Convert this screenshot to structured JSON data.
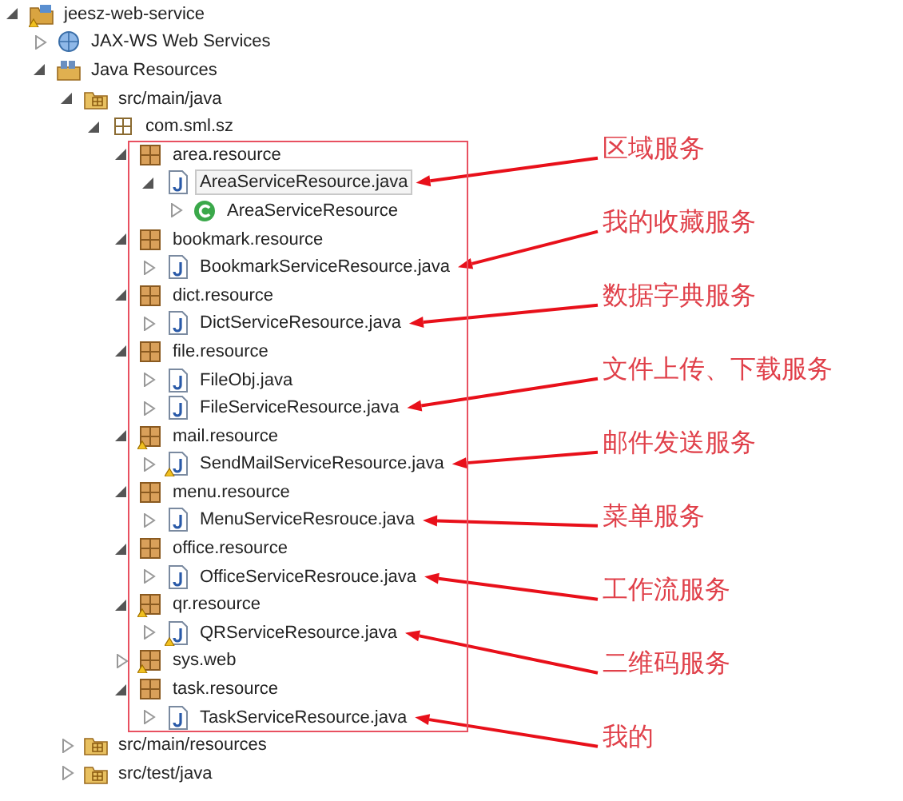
{
  "tree": [
    {
      "label": "jeesz-web-service",
      "kind": "project",
      "expanded": true,
      "warning": true,
      "selected": false,
      "children": [
        {
          "label": "JAX-WS Web Services",
          "kind": "web-services",
          "expanded": false,
          "warning": false,
          "selected": false
        },
        {
          "label": "Java Resources",
          "kind": "library-container",
          "expanded": true,
          "warning": false,
          "selected": false,
          "children": [
            {
              "label": "src/main/java",
              "kind": "source-folder",
              "expanded": true,
              "warning": false,
              "selected": false,
              "children": [
                {
                  "label": "com.sml.sz",
                  "kind": "package-root",
                  "expanded": true,
                  "warning": false,
                  "selected": false,
                  "framed": true,
                  "children": [
                    {
                      "label": "area.resource",
                      "kind": "package",
                      "expanded": true,
                      "warning": false,
                      "selected": false,
                      "children": [
                        {
                          "label": "AreaServiceResource.java",
                          "kind": "java-file",
                          "expanded": true,
                          "warning": false,
                          "selected": true,
                          "note": "区域服务",
                          "children": [
                            {
                              "label": "AreaServiceResource",
                              "kind": "class",
                              "expanded": false,
                              "warning": false,
                              "selected": false
                            }
                          ]
                        }
                      ]
                    },
                    {
                      "label": "bookmark.resource",
                      "kind": "package",
                      "expanded": true,
                      "warning": false,
                      "selected": false,
                      "children": [
                        {
                          "label": "BookmarkServiceResource.java",
                          "kind": "java-file",
                          "expanded": false,
                          "warning": false,
                          "selected": false,
                          "note": "我的收藏服务"
                        }
                      ]
                    },
                    {
                      "label": "dict.resource",
                      "kind": "package",
                      "expanded": true,
                      "warning": false,
                      "selected": false,
                      "children": [
                        {
                          "label": "DictServiceResource.java",
                          "kind": "java-file",
                          "expanded": false,
                          "warning": false,
                          "selected": false,
                          "note": "数据字典服务"
                        }
                      ]
                    },
                    {
                      "label": "file.resource",
                      "kind": "package",
                      "expanded": true,
                      "warning": false,
                      "selected": false,
                      "children": [
                        {
                          "label": "FileObj.java",
                          "kind": "java-file",
                          "expanded": false,
                          "warning": false,
                          "selected": false
                        },
                        {
                          "label": "FileServiceResource.java",
                          "kind": "java-file",
                          "expanded": false,
                          "warning": false,
                          "selected": false,
                          "note": "文件上传、下载服务"
                        }
                      ]
                    },
                    {
                      "label": "mail.resource",
                      "kind": "package",
                      "expanded": true,
                      "warning": true,
                      "selected": false,
                      "children": [
                        {
                          "label": "SendMailServiceResource.java",
                          "kind": "java-file",
                          "expanded": false,
                          "warning": true,
                          "selected": false,
                          "note": "邮件发送服务"
                        }
                      ]
                    },
                    {
                      "label": "menu.resource",
                      "kind": "package",
                      "expanded": true,
                      "warning": false,
                      "selected": false,
                      "children": [
                        {
                          "label": "MenuServiceResrouce.java",
                          "kind": "java-file",
                          "expanded": false,
                          "warning": false,
                          "selected": false,
                          "note": "菜单服务"
                        }
                      ]
                    },
                    {
                      "label": "office.resource",
                      "kind": "package",
                      "expanded": true,
                      "warning": false,
                      "selected": false,
                      "children": [
                        {
                          "label": "OfficeServiceResrouce.java",
                          "kind": "java-file",
                          "expanded": false,
                          "warning": false,
                          "selected": false,
                          "note": "工作流服务"
                        }
                      ]
                    },
                    {
                      "label": "qr.resource",
                      "kind": "package",
                      "expanded": true,
                      "warning": true,
                      "selected": false,
                      "children": [
                        {
                          "label": "QRServiceResource.java",
                          "kind": "java-file",
                          "expanded": false,
                          "warning": true,
                          "selected": false,
                          "note": "二维码服务"
                        }
                      ]
                    },
                    {
                      "label": "sys.web",
                      "kind": "package",
                      "expanded": false,
                      "warning": true,
                      "selected": false
                    },
                    {
                      "label": "task.resource",
                      "kind": "package",
                      "expanded": true,
                      "warning": false,
                      "selected": false,
                      "children": [
                        {
                          "label": "TaskServiceResource.java",
                          "kind": "java-file",
                          "expanded": false,
                          "warning": false,
                          "selected": false,
                          "note": "我的"
                        }
                      ]
                    }
                  ]
                }
              ]
            },
            {
              "label": "src/main/resources",
              "kind": "source-folder",
              "expanded": false,
              "warning": false,
              "selected": false
            },
            {
              "label": "src/test/java",
              "kind": "source-folder",
              "expanded": false,
              "warning": false,
              "selected": false
            }
          ]
        }
      ]
    }
  ]
}
